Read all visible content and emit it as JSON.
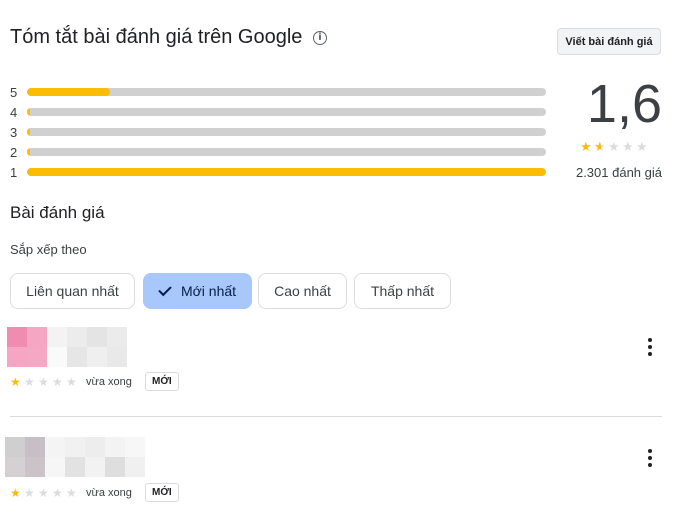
{
  "summary": {
    "title": "Tóm tắt bài đánh giá trên Google",
    "info_icon": "info-icon",
    "write_review_label": "Viết bài đánh giá",
    "distribution": [
      {
        "stars": "5",
        "fraction": 0.16
      },
      {
        "stars": "4",
        "fraction": 0.005
      },
      {
        "stars": "3",
        "fraction": 0.004
      },
      {
        "stars": "2",
        "fraction": 0.004
      },
      {
        "stars": "1",
        "fraction": 1.0
      }
    ],
    "average": "1,6",
    "average_stars": 1.5,
    "total_reviews": "2.301 đánh giá"
  },
  "reviews_section": {
    "title": "Bài đánh giá",
    "sort_label": "Sắp xếp theo",
    "sort_options": [
      {
        "label": "Liên quan nhất",
        "selected": false
      },
      {
        "label": "Mới nhất",
        "selected": true
      },
      {
        "label": "Cao nhất",
        "selected": false
      },
      {
        "label": "Thấp nhất",
        "selected": false
      }
    ]
  },
  "reviews": [
    {
      "rating": 1,
      "time": "vừa xong",
      "badge": "MỚI"
    },
    {
      "rating": 1,
      "time": "vừa xong",
      "badge": "MỚI"
    }
  ],
  "colors": {
    "star": "#fbbc04",
    "selected_chip": "#a8c7fa",
    "track": "#d0d0d0"
  }
}
